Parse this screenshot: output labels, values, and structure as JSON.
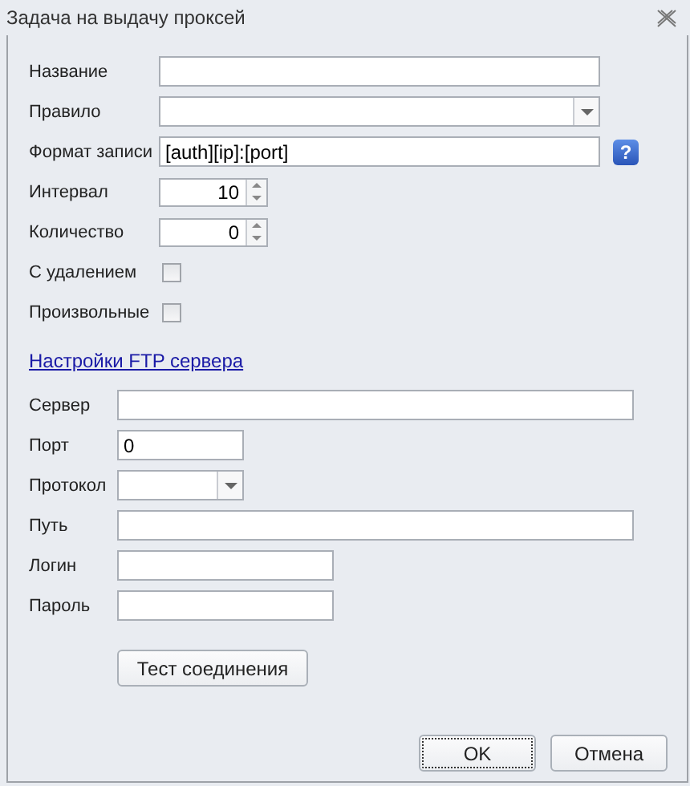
{
  "window": {
    "title": "Задача на выдачу проксей"
  },
  "task_fields": [
    {
      "kind": "text",
      "label": "Название"
    },
    {
      "kind": "combo",
      "label": "Правило"
    },
    {
      "kind": "text",
      "label": "Формат записи",
      "value": "[auth][ip]:[port]",
      "help": "?"
    },
    {
      "kind": "spin",
      "label": "Интервал",
      "value": "10"
    },
    {
      "kind": "spin",
      "label": "Количество",
      "value": "0"
    },
    {
      "kind": "check",
      "label": "С удалением",
      "checked": false
    },
    {
      "kind": "check",
      "label": "Произвольные",
      "checked": false
    }
  ],
  "ftp_link": "Настройки FTP сервера",
  "ftp_fields": [
    {
      "kind": "text",
      "label": "Сервер"
    },
    {
      "kind": "text",
      "label": "Порт",
      "value": "0"
    },
    {
      "kind": "combo",
      "label": "Протокол"
    },
    {
      "kind": "text",
      "label": "Путь"
    },
    {
      "kind": "text",
      "label": "Логин"
    },
    {
      "kind": "text",
      "label": "Пароль"
    }
  ],
  "test_button": "Тест соединения",
  "buttons": [
    {
      "label": "OK",
      "focused": true
    },
    {
      "label": "Отмена",
      "focused": false
    }
  ]
}
